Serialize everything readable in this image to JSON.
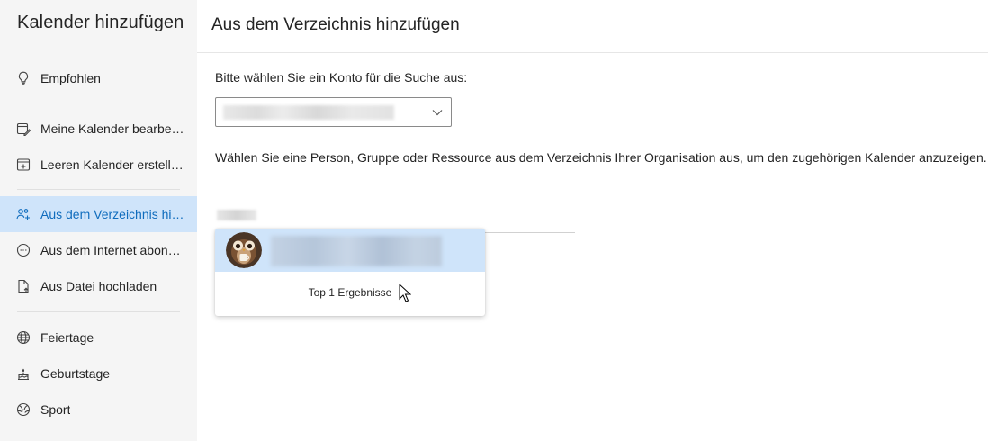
{
  "sidebar": {
    "title": "Kalender hinzufügen",
    "items": [
      {
        "label": "Empfohlen",
        "icon": "lightbulb-icon"
      },
      {
        "label": "Meine Kalender bearbeiten",
        "icon": "edit-calendar-icon"
      },
      {
        "label": "Leeren Kalender erstellen",
        "icon": "add-calendar-icon"
      },
      {
        "label": "Aus dem Verzeichnis hinzufügen",
        "icon": "people-add-icon",
        "active": true
      },
      {
        "label": "Aus dem Internet abonnieren",
        "icon": "link-circle-icon"
      },
      {
        "label": "Aus Datei hochladen",
        "icon": "file-upload-icon"
      },
      {
        "label": "Feiertage",
        "icon": "globe-icon"
      },
      {
        "label": "Geburtstage",
        "icon": "birthday-cake-icon"
      },
      {
        "label": "Sport",
        "icon": "sports-ball-icon"
      }
    ]
  },
  "main": {
    "title": "Aus dem Verzeichnis hinzufügen",
    "account_prompt": "Bitte wählen Sie ein Konto für die Suche aus:",
    "description": "Wählen Sie eine Person, Gruppe oder Ressource aus dem Verzeichnis Ihrer Organisation aus, um den zugehörigen Kalender anzuzeigen.",
    "results_count": "Top 1 Ergebnisse"
  },
  "colors": {
    "accent": "#0f6cbd",
    "active_bg": "#cfe4fa",
    "sidebar_bg": "#f5f5f5"
  }
}
